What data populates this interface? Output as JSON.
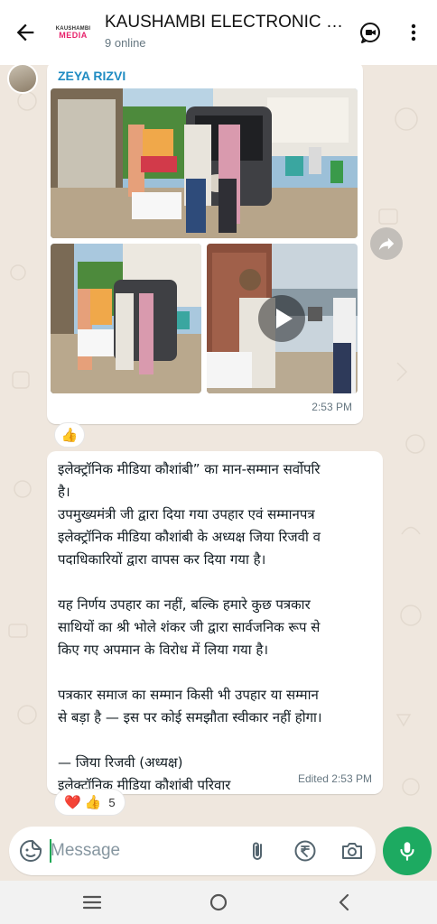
{
  "header": {
    "group_logo_line1": "KAUSHAMBI",
    "group_logo_line2": "MEDIA",
    "title": "KAUSHAMBI ELECTRONIC M...",
    "subtitle": "9 online"
  },
  "message1": {
    "sender": "ZEYA RIZVI",
    "time": "2:53 PM",
    "reaction": "👍"
  },
  "message2": {
    "text": "इलेक्ट्रॉनिक मीडिया कौशांबी” का मान-सम्मान सर्वोपरि\nहै।\nउपमुख्यमंत्री जी द्वारा दिया गया उपहार एवं सम्मानपत्र\nइलेक्ट्रॉनिक मीडिया कौशांबी के अध्यक्ष जिया रिजवी व\nपदाधिकारियों द्वारा वापस कर दिया गया है।\n\nयह निर्णय उपहार का नहीं, बल्कि हमारे कुछ पत्रकार\nसाथियों का श्री भोले शंकर जी द्वारा सार्वजनिक रूप से\nकिए गए अपमान के विरोध में लिया गया है।\n\nपत्रकार समाज का सम्मान किसी भी उपहार या सम्मान\nसे बड़ा है — इस पर कोई समझौता स्वीकार नहीं होगा।\n\n— जिया रिजवी (अध्यक्ष)\nइलेक्ट्रॉनिक मीडिया कौशांबी परिवार",
    "time": "Edited 2:53 PM",
    "reaction_heart": "❤️",
    "reaction_thumb": "👍",
    "reaction_count": "5"
  },
  "input": {
    "placeholder": "Message"
  },
  "colors": {
    "accent": "#1daa61",
    "sender": "#1f8bc2",
    "chat_bg": "#efe7de"
  },
  "icons": [
    "back-arrow-icon",
    "video-call-icon",
    "more-vert-icon",
    "forward-icon",
    "play-icon",
    "emoji-sticker-icon",
    "attach-icon",
    "rupee-icon",
    "camera-icon",
    "mic-icon",
    "nav-menu-icon",
    "nav-home-icon",
    "nav-back-icon"
  ]
}
